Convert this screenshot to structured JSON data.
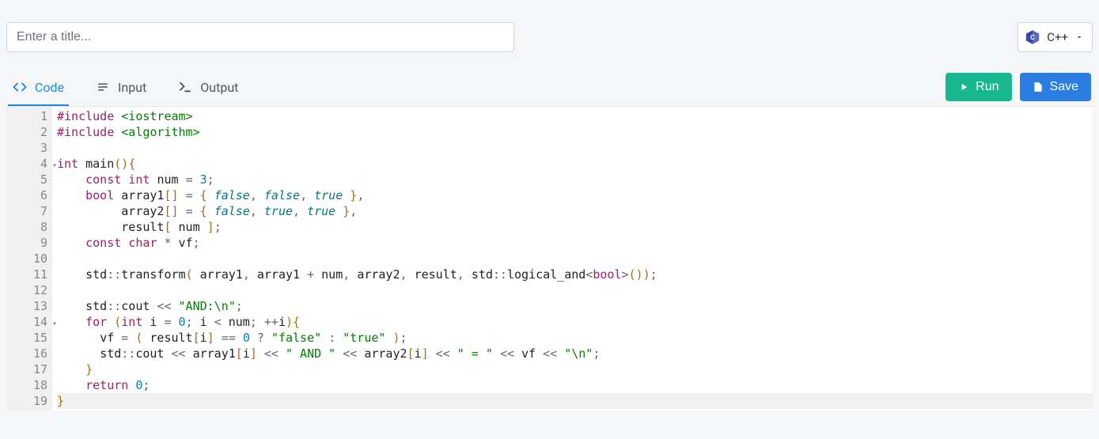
{
  "header": {
    "title_placeholder": "Enter a title...",
    "title_value": "",
    "language_label": "C++"
  },
  "tabs": {
    "code": "Code",
    "input": "Input",
    "output": "Output"
  },
  "buttons": {
    "run": "Run",
    "save": "Save"
  },
  "editor": {
    "line_count": 19,
    "fold_lines": [
      4,
      14
    ],
    "highlight_line": 19,
    "lines": [
      "#include <iostream>",
      "#include <algorithm>",
      "",
      "int main(){",
      "    const int num = 3;",
      "    bool array1[] = { false, false, true },",
      "         array2[] = { false, true, true },",
      "         result[ num ];",
      "    const char * vf;",
      "",
      "    std::transform( array1, array1 + num, array2, result, std::logical_and<bool>());",
      "",
      "    std::cout << \"AND:\\n\";",
      "    for (int i = 0; i < num; ++i){",
      "      vf = ( result[i] == 0 ? \"false\" : \"true\" );",
      "      std::cout << array1[i] << \" AND \" << array2[i] << \" = \" << vf << \"\\n\";",
      "    }",
      "    return 0;",
      "}"
    ]
  }
}
